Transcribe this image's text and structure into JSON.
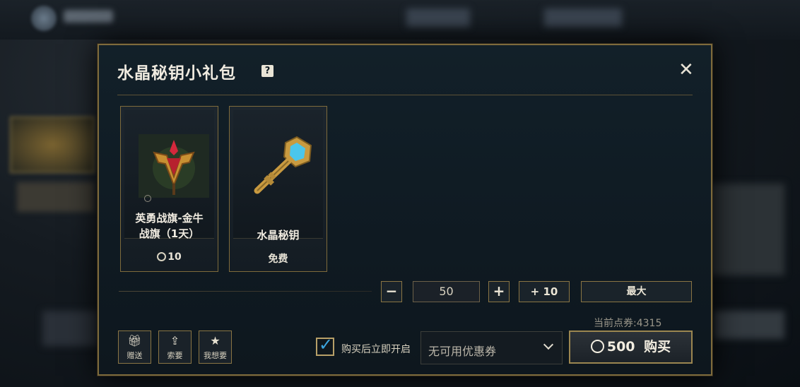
{
  "dialog": {
    "title": "水晶秘钥小礼包",
    "help_icon": "question-icon",
    "close_icon": "close-icon"
  },
  "items": [
    {
      "name": "英勇战旗-金牛战旗（1天）",
      "name_line1": "英勇战旗-金牛",
      "name_line2": "战旗（1天）",
      "price": "10",
      "icon": "banner-icon"
    },
    {
      "name": "水晶秘钥",
      "price": "免费",
      "icon": "key-icon"
    }
  ],
  "quantity": {
    "minus_label": "−",
    "value": "50",
    "plus_label": "+",
    "plus10_label": "+ 10",
    "max_label": "最大"
  },
  "balance": "当前点券:4315",
  "actions": {
    "gift": {
      "label": "赠送",
      "icon": "gift-icon"
    },
    "request": {
      "label": "索要",
      "icon": "request-icon"
    },
    "wishlist": {
      "label": "我想要",
      "icon": "star-icon"
    }
  },
  "open_after_purchase": {
    "label": "购买后立即开启",
    "checked": true
  },
  "coupon": {
    "value": "无可用优惠券"
  },
  "buy": {
    "price": "500",
    "label": "购买"
  },
  "colors": {
    "gold_border": "#7e6b3c",
    "checkbox_tick": "#3ca6e0",
    "panel_bg": "#122029"
  }
}
